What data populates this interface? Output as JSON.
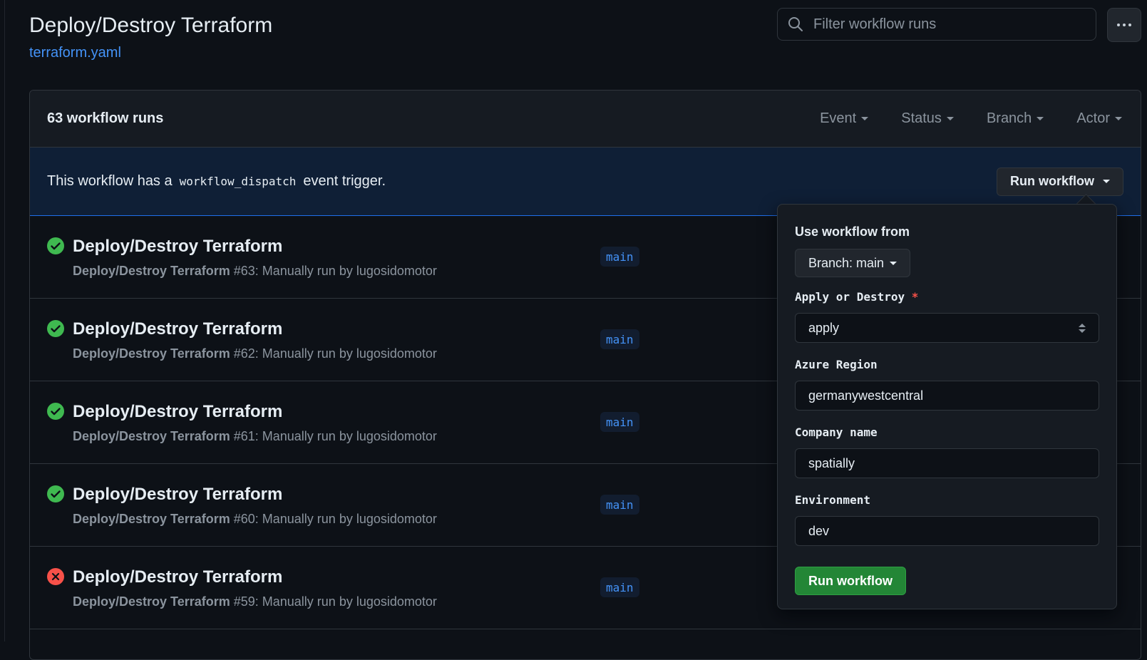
{
  "page": {
    "title": "Deploy/Destroy Terraform",
    "workflow_file": "terraform.yaml",
    "search_placeholder": "Filter workflow runs"
  },
  "list": {
    "runs_count": "63 workflow runs",
    "filters": [
      "Event",
      "Status",
      "Branch",
      "Actor"
    ],
    "banner": {
      "prefix": "This workflow has a",
      "code": "workflow_dispatch",
      "suffix": "event trigger.",
      "button_label": "Run workflow"
    },
    "runs": [
      {
        "status": "success",
        "status_icon": "check-circle-icon",
        "title": "Deploy/Destroy Terraform",
        "sub_bold": "Deploy/Destroy Terraform",
        "sub_rest": " #63: Manually run by lugosidomotor",
        "branch": "main"
      },
      {
        "status": "success",
        "status_icon": "check-circle-icon",
        "title": "Deploy/Destroy Terraform",
        "sub_bold": "Deploy/Destroy Terraform",
        "sub_rest": " #62: Manually run by lugosidomotor",
        "branch": "main"
      },
      {
        "status": "success",
        "status_icon": "check-circle-icon",
        "title": "Deploy/Destroy Terraform",
        "sub_bold": "Deploy/Destroy Terraform",
        "sub_rest": " #61: Manually run by lugosidomotor",
        "branch": "main"
      },
      {
        "status": "success",
        "status_icon": "check-circle-icon",
        "title": "Deploy/Destroy Terraform",
        "sub_bold": "Deploy/Destroy Terraform",
        "sub_rest": " #60: Manually run by lugosidomotor",
        "branch": "main"
      },
      {
        "status": "failure",
        "status_icon": "x-circle-icon",
        "title": "Deploy/Destroy Terraform",
        "sub_bold": "Deploy/Destroy Terraform",
        "sub_rest": " #59: Manually run by lugosidomotor",
        "branch": "main"
      }
    ]
  },
  "popover": {
    "use_from_label": "Use workflow from",
    "branch_select": "Branch: main",
    "apply_label": "Apply or Destroy",
    "required_mark": "*",
    "apply_value": "apply",
    "region_label": "Azure Region",
    "region_value": "germanywestcentral",
    "company_label": "Company name",
    "company_value": "spatially",
    "env_label": "Environment",
    "env_value": "dev",
    "submit_label": "Run workflow"
  },
  "colors": {
    "background": "#0d1117",
    "accent_link": "#4493f8",
    "success": "#3fb950",
    "failure": "#f85149",
    "primary_button": "#238636"
  }
}
